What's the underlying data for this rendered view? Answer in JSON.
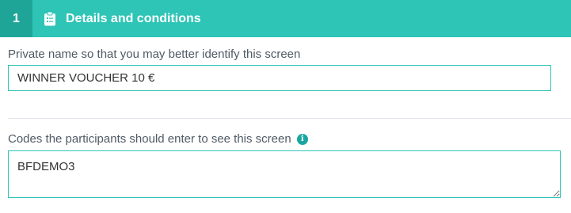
{
  "section": {
    "step_number": "1",
    "title": "Details and conditions",
    "icon": "clipboard-icon"
  },
  "private_name": {
    "label": "Private name so that you may better identify this screen",
    "value": "WINNER VOUCHER 10 €"
  },
  "codes": {
    "label": "Codes the participants should enter to see this screen",
    "value": "BFDEMO3",
    "info_icon": "info-icon"
  },
  "colors": {
    "header": "#2ec4b6",
    "step_badge": "#1fa597",
    "input_border": "#2ec4b6",
    "info_icon": "#1aa6a0"
  }
}
